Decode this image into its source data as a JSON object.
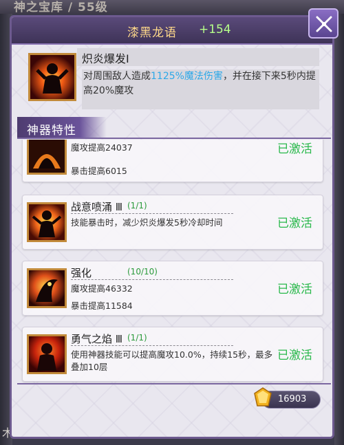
{
  "background": {
    "top_title": "神之宝库 / 55级",
    "bottom_char": "木"
  },
  "header": {
    "artifact_name": "漆黑龙语",
    "score": "+154"
  },
  "skill": {
    "title": "炽炎爆发Ⅰ",
    "desc_before": "对周围敌人造成",
    "desc_highlight": "1125%魔法伤害",
    "desc_after": "，并在接下来5秒内提高20%魔攻"
  },
  "section": {
    "title": "神器特性"
  },
  "traits": [
    {
      "name": "",
      "level": "",
      "line1": "魔攻提高24037",
      "line2": "暴击提高6015",
      "status": "已激活"
    },
    {
      "name": "战意喷涌 Ⅲ",
      "level": "(1/1)",
      "line1": "技能暴击时，减少炽炎爆发5秒冷却时间",
      "line2": "",
      "status": "已激活"
    },
    {
      "name": "强化",
      "level": "(10/10)",
      "line1": "魔攻提高46332",
      "line2": "暴击提高11584",
      "status": "已激活"
    },
    {
      "name": "勇气之焰 Ⅲ",
      "level": "(1/1)",
      "line1": "使用神器技能可以提高魔攻10.0%，持续15秒，最多叠加10层",
      "line2": "",
      "status": "已激活"
    }
  ],
  "currency": {
    "value": "16903",
    "icon": "gem-icon"
  },
  "colors": {
    "status_green": "#28b84a",
    "highlight_blue": "#2ca8e8",
    "header_purple": "#4e3c70"
  }
}
